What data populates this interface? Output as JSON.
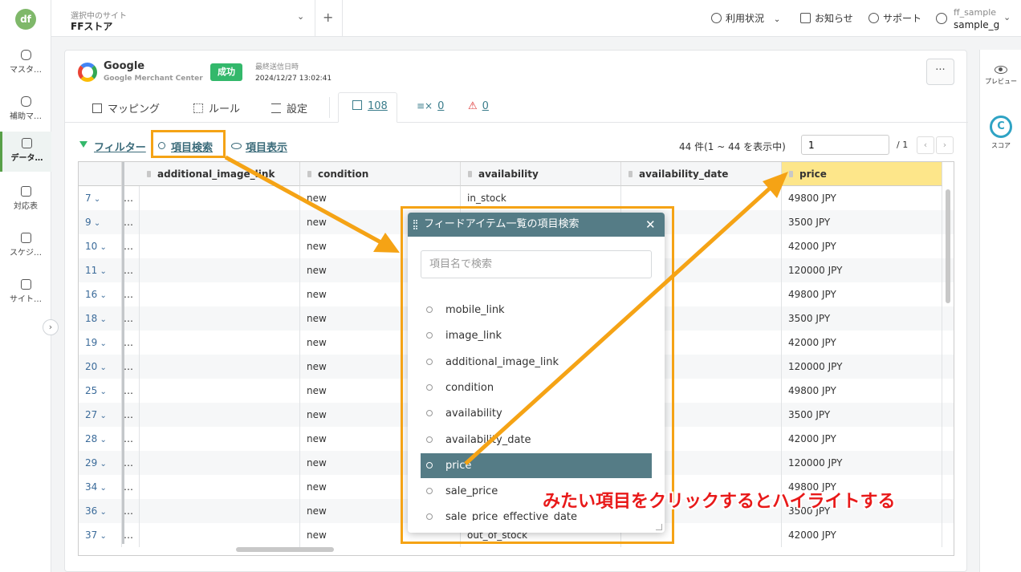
{
  "nav": {
    "logo": "df",
    "items": [
      {
        "label": "マスタ…",
        "icon": "database-icon"
      },
      {
        "label": "補助マ…",
        "icon": "database-plus-icon"
      },
      {
        "label": "データ…",
        "icon": "document-icon",
        "active": true
      },
      {
        "label": "対応表",
        "icon": "table-icon"
      },
      {
        "label": "スケジ…",
        "icon": "calendar-clock-icon"
      },
      {
        "label": "サイト…",
        "icon": "sliders-icon"
      }
    ],
    "toggle": "›"
  },
  "topbar": {
    "site_caption": "選択中のサイト",
    "site_name": "FFストア",
    "chevron": "⌄",
    "add": "+",
    "links": {
      "usage": "利用状況",
      "news": "お知らせ",
      "support": "サポート"
    },
    "user_sub": "ff_sample",
    "user_name": "sample_g"
  },
  "right_panel": {
    "preview": "プレビュー",
    "score": "スコア",
    "score_letter": "C"
  },
  "card": {
    "service_name": "Google",
    "service_sub": "Google Merchant Center",
    "badge": "成功",
    "last_sent_caption": "最終送信日時",
    "last_sent_value": "2024/12/27 13:02:41",
    "more": "···"
  },
  "tabs": {
    "mapping": "マッピング",
    "rule": "ルール",
    "settings": "設定",
    "items_count": "108",
    "excluded_count": "0",
    "errors_count": "0"
  },
  "toolbar": {
    "filter": "フィルター",
    "search_fields": "項目検索",
    "show_fields": "項目表示",
    "result_count": "44 件(1 ~ 44 を表示中)",
    "page_value": "1",
    "page_total": "/ 1",
    "prev": "‹",
    "next": "›"
  },
  "table": {
    "columns": [
      "additional_image_link",
      "condition",
      "availability",
      "availability_date",
      "price"
    ],
    "highlighted_column": "price",
    "rows": [
      {
        "id": "7",
        "condition": "new",
        "availability": "in_stock",
        "price": "49800 JPY"
      },
      {
        "id": "9",
        "condition": "new",
        "availability": "",
        "price": "3500 JPY"
      },
      {
        "id": "10",
        "condition": "new",
        "availability": "",
        "price": "42000 JPY"
      },
      {
        "id": "11",
        "condition": "new",
        "availability": "",
        "price": "120000 JPY"
      },
      {
        "id": "16",
        "condition": "new",
        "availability": "",
        "price": "49800 JPY"
      },
      {
        "id": "18",
        "condition": "new",
        "availability": "",
        "price": "3500 JPY"
      },
      {
        "id": "19",
        "condition": "new",
        "availability": "",
        "price": "42000 JPY"
      },
      {
        "id": "20",
        "condition": "new",
        "availability": "",
        "price": "120000 JPY"
      },
      {
        "id": "25",
        "condition": "new",
        "availability": "",
        "price": "49800 JPY"
      },
      {
        "id": "27",
        "condition": "new",
        "availability": "",
        "price": "3500 JPY"
      },
      {
        "id": "28",
        "condition": "new",
        "availability": "",
        "price": "42000 JPY"
      },
      {
        "id": "29",
        "condition": "new",
        "availability": "",
        "price": "120000 JPY"
      },
      {
        "id": "34",
        "condition": "new",
        "availability": "",
        "price": "49800 JPY"
      },
      {
        "id": "36",
        "condition": "new",
        "availability": "",
        "price": "3500 JPY"
      },
      {
        "id": "37",
        "condition": "new",
        "availability": "out_of_stock",
        "price": "42000 JPY"
      }
    ]
  },
  "popup": {
    "title": "フィードアイテム一覧の項目検索",
    "close": "✕",
    "search_placeholder": "項目名で検索",
    "items": [
      "mobile_link",
      "image_link",
      "additional_image_link",
      "condition",
      "availability",
      "availability_date",
      "price",
      "sale_price",
      "sale_price_effective_date"
    ],
    "selected": "price"
  },
  "annotation": {
    "text": "みたい項目をクリックするとハイライトする",
    "color": "#f5a315",
    "text_color": "#e81919"
  }
}
